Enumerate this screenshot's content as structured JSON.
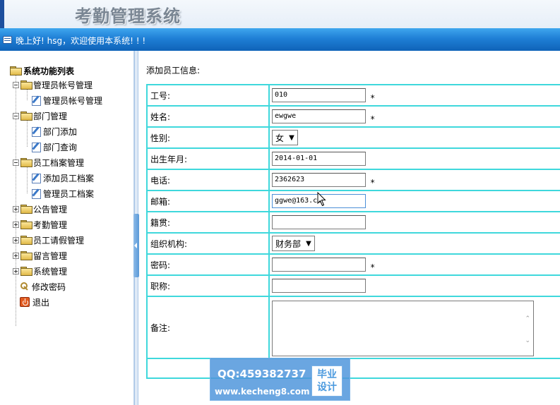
{
  "header": {
    "app_title": "考勤管理系统",
    "welcome": "晚上好! hsg，欢迎使用本系统! ! !"
  },
  "sidebar": {
    "root": "系统功能列表",
    "groups": [
      {
        "label": "管理员帐号管理",
        "expanded": true,
        "children": [
          "管理员帐号管理"
        ]
      },
      {
        "label": "部门管理",
        "expanded": true,
        "children": [
          "部门添加",
          "部门查询"
        ]
      },
      {
        "label": "员工档案管理",
        "expanded": true,
        "children": [
          "添加员工档案",
          "管理员工档案"
        ]
      },
      {
        "label": "公告管理",
        "expanded": false
      },
      {
        "label": "考勤管理",
        "expanded": false
      },
      {
        "label": "员工请假管理",
        "expanded": false
      },
      {
        "label": "留言管理",
        "expanded": false
      },
      {
        "label": "系统管理",
        "expanded": false
      }
    ],
    "change_password": "修改密码",
    "logout": "退出"
  },
  "form": {
    "heading": "添加员工信息:",
    "fields": [
      {
        "label": "工号:",
        "value": "010",
        "required": "*"
      },
      {
        "label": "姓名:",
        "value": "ewgwe",
        "required": "*"
      },
      {
        "label": "性别:",
        "value": "女"
      },
      {
        "label": "出生年月:",
        "value": "2014-01-01"
      },
      {
        "label": "电话:",
        "value": "2362623",
        "required": "*"
      },
      {
        "label": "邮箱:",
        "value": "ggwe@163.co"
      },
      {
        "label": "籍贯:",
        "value": ""
      },
      {
        "label": "组织机构:",
        "value": "财务部"
      },
      {
        "label": "密码:",
        "value": "",
        "required": "*"
      },
      {
        "label": "职称:",
        "value": ""
      },
      {
        "label": "备注:",
        "value": ""
      }
    ]
  },
  "watermark": {
    "qq": "QQ:459382737",
    "site": "www.kecheng8.com",
    "badge_line1": "毕业",
    "badge_line2": "设计"
  },
  "colors": {
    "accent_blue": "#1f7fd6",
    "table_border": "#3fd8dc",
    "watermark_bg": "#5096dc"
  },
  "icons": {
    "folder": "folder-icon",
    "document": "edit-document-icon",
    "expand": "tree-expand-icon",
    "collapse": "tree-collapse-icon",
    "key": "key-icon",
    "exit": "exit-icon",
    "cursor": "mouse-cursor-icon"
  }
}
